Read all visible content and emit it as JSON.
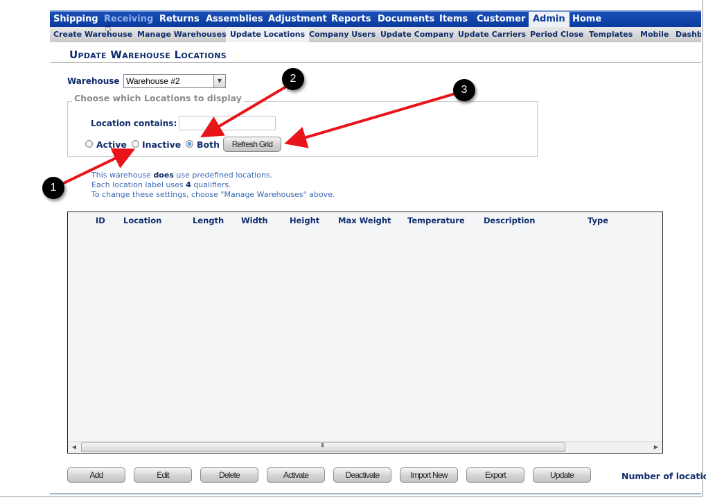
{
  "top_nav": [
    {
      "label": "Shipping",
      "state": "normal"
    },
    {
      "label": "Receiving",
      "state": "hover"
    },
    {
      "label": "Returns",
      "state": "normal"
    },
    {
      "label": "Assemblies",
      "state": "normal"
    },
    {
      "label": "Adjustment",
      "state": "normal"
    },
    {
      "label": "Reports",
      "state": "normal"
    },
    {
      "label": "Documents",
      "state": "normal"
    },
    {
      "label": "Items",
      "state": "normal"
    },
    {
      "label": "Customer",
      "state": "normal"
    },
    {
      "label": "Admin",
      "state": "active"
    },
    {
      "label": "Home",
      "state": "normal"
    }
  ],
  "sub_nav": [
    {
      "label": "Create Warehouse",
      "state": "normal"
    },
    {
      "label": "Manage Warehouses",
      "state": "normal"
    },
    {
      "label": "Update Locations",
      "state": "active"
    },
    {
      "label": "Company Users",
      "state": "normal"
    },
    {
      "label": "Update Company",
      "state": "normal"
    },
    {
      "label": "Update Carriers",
      "state": "normal"
    },
    {
      "label": "Period Close",
      "state": "normal"
    },
    {
      "label": "Templates",
      "state": "normal"
    },
    {
      "label": "Mobile",
      "state": "normal"
    },
    {
      "label": "Dashb",
      "state": "normal"
    }
  ],
  "page_title": "Update Warehouse Locations",
  "warehouse": {
    "label": "Warehouse",
    "selected": "Warehouse #2",
    "dropdown_icon": "chevron-down-icon"
  },
  "filter": {
    "legend": "Choose which Locations to display",
    "location_contains_label": "Location contains:",
    "location_contains_value": "",
    "radios": [
      {
        "label": "Active",
        "checked": false
      },
      {
        "label": "Inactive",
        "checked": false
      },
      {
        "label": "Both",
        "checked": true
      }
    ],
    "refresh_button": "Refresh Grid"
  },
  "info": {
    "line1_pre": "This warehouse ",
    "line1_bold": "does",
    "line1_post": " use predefined locations.",
    "line2_pre": "Each location label uses ",
    "line2_bold": "4",
    "line2_post": " qualifiers.",
    "line3": "To change these settings, choose \"Manage Warehouses\" above."
  },
  "grid": {
    "columns": [
      "ID",
      "Location",
      "Length",
      "Width",
      "Height",
      "Max Weight",
      "Temperature",
      "Description",
      "Type"
    ],
    "rows": [],
    "scrollbar_grip": "III"
  },
  "actions": [
    "Add",
    "Edit",
    "Delete",
    "Activate",
    "Deactivate",
    "Import New",
    "Export",
    "Update"
  ],
  "count_label": "Number of locatio",
  "callouts": [
    "1",
    "2",
    "3"
  ],
  "colors": {
    "nav_blue": "#0a3a9c",
    "label_navy": "#0f2c6c",
    "info_blue": "#3a67b5",
    "arrow_red": "#e8141a"
  }
}
